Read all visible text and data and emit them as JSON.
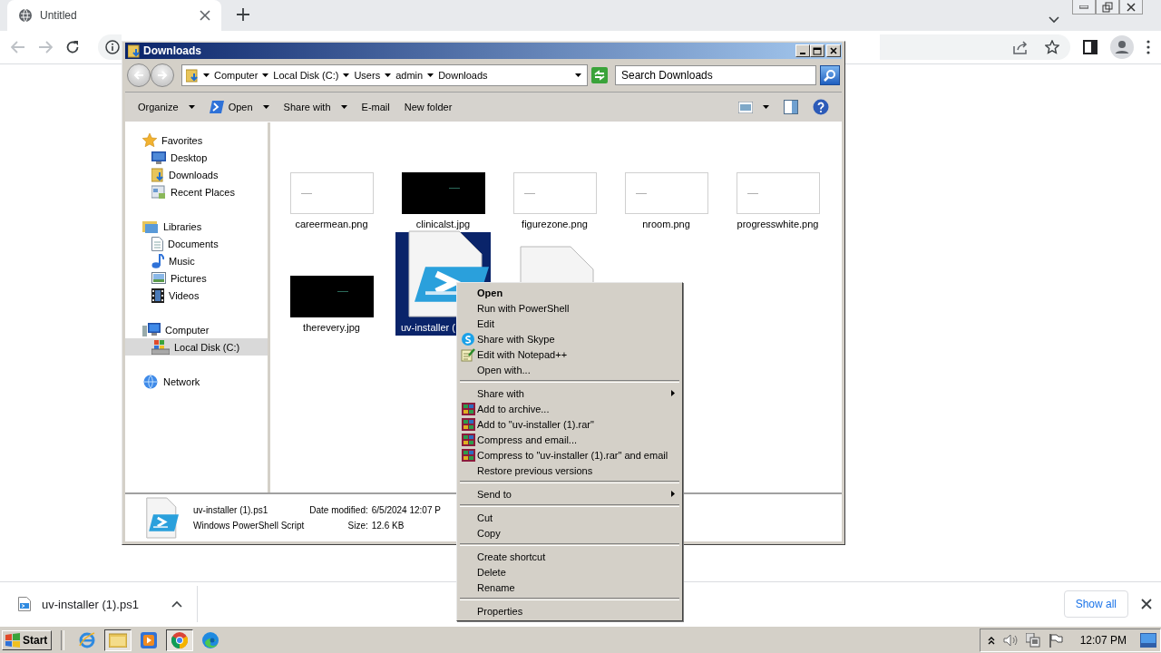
{
  "browser": {
    "tab": {
      "title": "Untitled",
      "selected": true
    }
  },
  "explorer": {
    "title": "Downloads",
    "breadcrumb": [
      "Computer",
      "Local Disk (C:)",
      "Users",
      "admin",
      "Downloads"
    ],
    "search": {
      "placeholder": "Search Downloads"
    },
    "commands": [
      {
        "label": "Organize",
        "kind": "menu"
      },
      {
        "label": "Open",
        "kind": "split"
      },
      {
        "label": "Share with",
        "kind": "menu"
      },
      {
        "label": "E-mail",
        "kind": "plain"
      },
      {
        "label": "New folder",
        "kind": "plain"
      }
    ],
    "navigation": [
      {
        "label": "Favorites",
        "selected": false,
        "children": [
          {
            "label": "Desktop",
            "selected": false
          },
          {
            "label": "Downloads",
            "selected": false
          },
          {
            "label": "Recent Places",
            "selected": false
          }
        ]
      },
      {
        "label": "Libraries",
        "selected": false,
        "children": [
          {
            "label": "Documents",
            "selected": false
          },
          {
            "label": "Music",
            "selected": false
          },
          {
            "label": "Pictures",
            "selected": false
          },
          {
            "label": "Videos",
            "selected": false
          }
        ]
      },
      {
        "label": "Computer",
        "selected": false,
        "children": [
          {
            "label": "Local Disk (C:)",
            "selected": true
          }
        ]
      },
      {
        "label": "Network",
        "selected": false
      }
    ],
    "files": [
      {
        "name": "careermean.png",
        "kind": "light-image",
        "selected": false
      },
      {
        "name": "clinicalst.jpg",
        "kind": "dark-image",
        "selected": false
      },
      {
        "name": "figurezone.png",
        "kind": "light-image",
        "selected": false
      },
      {
        "name": "nroom.png",
        "kind": "light-image",
        "selected": false
      },
      {
        "name": "progresswhite.png",
        "kind": "light-image",
        "selected": false
      },
      {
        "name": "therevery.jpg",
        "kind": "dark-image",
        "selected": false
      },
      {
        "name": "uv-installer (",
        "kind": "script",
        "selected": true
      },
      {
        "kind": "script",
        "selected": false
      }
    ],
    "details": {
      "name": "uv-installer (1).ps1",
      "type": "Windows PowerShell Script",
      "fields": [
        {
          "label": "Date modified:",
          "value": "6/5/2024 12:07 P"
        },
        {
          "label": "Size:",
          "value": "12.6 KB"
        }
      ]
    }
  },
  "context_menu": [
    {
      "label": "Open",
      "kind": "default"
    },
    {
      "label": "Run with PowerShell",
      "kind": "item"
    },
    {
      "label": "Edit",
      "kind": "item"
    },
    {
      "label": "Share with Skype",
      "kind": "skype"
    },
    {
      "label": "Edit with Notepad++",
      "kind": "notepad"
    },
    {
      "label": "Open with...",
      "kind": "item"
    },
    {
      "kind": "separator"
    },
    {
      "label": "Share with",
      "kind": "submenu"
    },
    {
      "label": "Add to archive...",
      "kind": "archive"
    },
    {
      "label": "Add to \"uv-installer (1).rar\"",
      "kind": "archive"
    },
    {
      "label": "Compress and email...",
      "kind": "archive"
    },
    {
      "label": "Compress to \"uv-installer (1).rar\" and email",
      "kind": "archive"
    },
    {
      "label": "Restore previous versions",
      "kind": "item"
    },
    {
      "kind": "separator"
    },
    {
      "label": "Send to",
      "kind": "submenu"
    },
    {
      "kind": "separator"
    },
    {
      "label": "Cut",
      "kind": "item"
    },
    {
      "label": "Copy",
      "kind": "item"
    },
    {
      "kind": "separator"
    },
    {
      "label": "Create shortcut",
      "kind": "item"
    },
    {
      "label": "Delete",
      "kind": "item"
    },
    {
      "label": "Rename",
      "kind": "item"
    },
    {
      "kind": "separator"
    },
    {
      "label": "Properties",
      "kind": "item"
    }
  ],
  "download_bar": {
    "file": "uv-installer (1).ps1",
    "show_all": "Show all"
  },
  "taskbar": {
    "start": "Start",
    "apps": [
      {
        "selected": false
      },
      {
        "selected": true
      },
      {
        "selected": false
      },
      {
        "selected": true
      },
      {
        "selected": false
      }
    ],
    "clock": "12:07 PM"
  }
}
